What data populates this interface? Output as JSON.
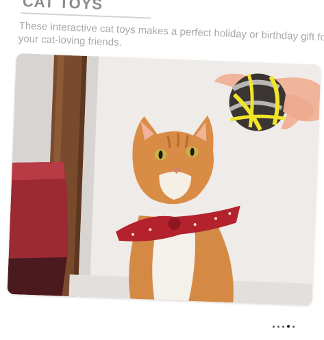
{
  "header": {
    "title": "CAT TOYS",
    "subtitle": "These interactive cat toys makes a perfect holiday or birthday gift for your cat-loving friends."
  },
  "colors": {
    "title": "#8c8c8c",
    "subtitle": "#a8a8a8",
    "cat_fur": "#d98c45",
    "bandana": "#b3222d",
    "ball_yellow": "#f1e52a"
  },
  "carousel": {
    "slide_count": 5,
    "active_index": 3
  }
}
